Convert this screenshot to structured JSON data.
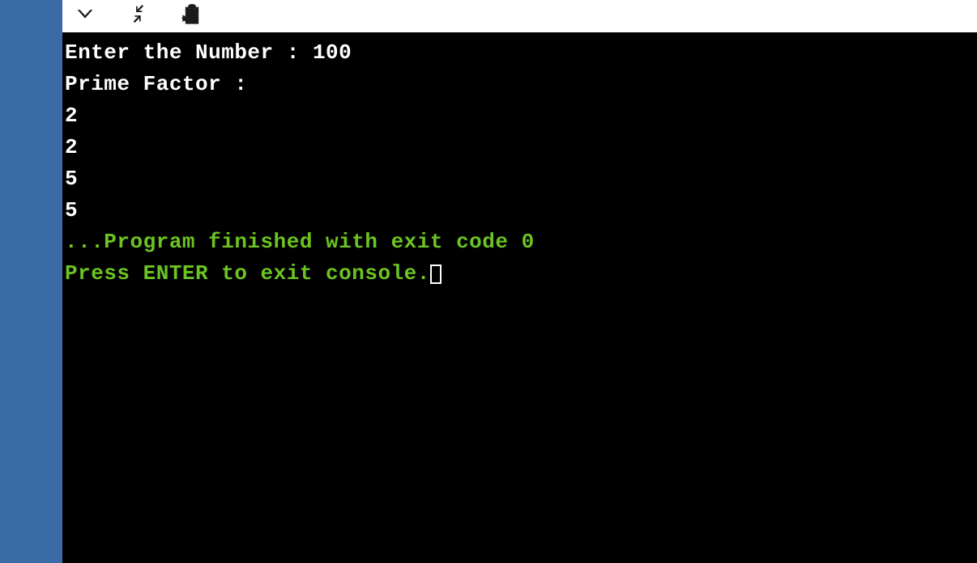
{
  "toolbar": {
    "icons": {
      "chevron_down": "chevron-down-icon",
      "collapse": "collapse-icon",
      "clipboard": "clipboard-icon"
    }
  },
  "console": {
    "line1": "Enter the Number : 100",
    "line2": "Prime Factor :",
    "factor1": "2",
    "factor2": "2",
    "factor3": "5",
    "factor4": "5",
    "blank": "",
    "status1": "...Program finished with exit code 0",
    "status2": "Press ENTER to exit console."
  }
}
